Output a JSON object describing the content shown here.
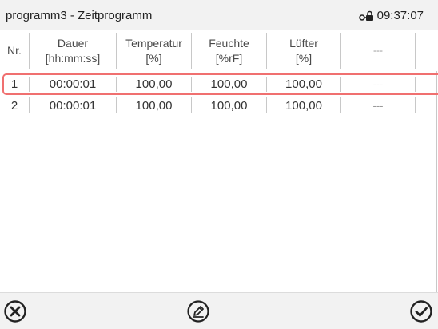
{
  "header": {
    "title": "programm3 - Zeitprogramm",
    "time": "09:37:07",
    "lock_icon": "lock-key-icon"
  },
  "table": {
    "columns": [
      {
        "line1": "Nr.",
        "line2": ""
      },
      {
        "line1": "Dauer",
        "line2": "[hh:mm:ss]"
      },
      {
        "line1": "Temperatur",
        "line2": "[%]"
      },
      {
        "line1": "Feuchte",
        "line2": "[%rF]"
      },
      {
        "line1": "Lüfter",
        "line2": "[%]"
      },
      {
        "line1": "---",
        "line2": ""
      }
    ],
    "rows": [
      {
        "nr": "1",
        "dauer": "00:00:01",
        "temperatur": "100,00",
        "feuchte": "100,00",
        "luefter": "100,00",
        "extra": "---",
        "selected": true
      },
      {
        "nr": "2",
        "dauer": "00:00:01",
        "temperatur": "100,00",
        "feuchte": "100,00",
        "luefter": "100,00",
        "extra": "---",
        "selected": false
      }
    ]
  },
  "footer": {
    "cancel_icon": "close-circle-icon",
    "edit_icon": "edit-pencil-icon",
    "confirm_icon": "check-circle-icon"
  },
  "colors": {
    "selection_border": "#f07070",
    "bar_background": "#f2f2f2"
  }
}
